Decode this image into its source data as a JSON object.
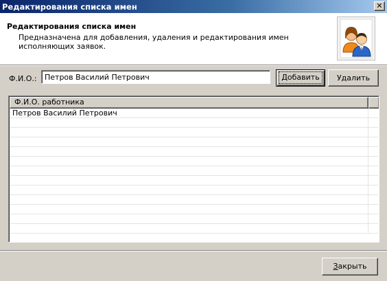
{
  "window": {
    "title": "Редактирования списка имен",
    "close_glyph": "✕"
  },
  "header": {
    "title": "Редактирования списка имен",
    "description": "Предназначена для добавления, удаления и редактирования имен исполняющих заявок.",
    "icon": "users-icon"
  },
  "form": {
    "fio_label": "Ф.И.О.:",
    "fio_value": "Петров Василий Петрович"
  },
  "buttons": {
    "add_accel": "Д",
    "add_rest": "обавить",
    "delete_label": "Удалить",
    "close_accel": "З",
    "close_rest": "акрыть"
  },
  "list": {
    "column_header": "Ф.И.О. работника",
    "rows": [
      "Петров Василий Петрович"
    ]
  },
  "colors": {
    "titlebar_start": "#0a246a",
    "titlebar_end": "#a6caf0",
    "face": "#d4d0c8"
  }
}
